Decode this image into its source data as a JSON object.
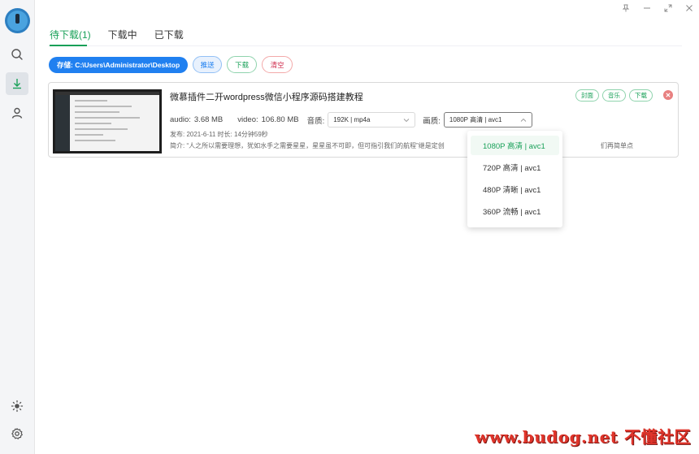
{
  "window_controls": [
    "pin-icon",
    "minimize-icon",
    "maximize-icon",
    "close-icon"
  ],
  "sidebar": {
    "avatar_text": "",
    "items": [
      {
        "name": "search",
        "icon": "search-icon"
      },
      {
        "name": "download",
        "icon": "download-icon",
        "active": true
      },
      {
        "name": "user",
        "icon": "user-icon"
      }
    ],
    "bottom": [
      {
        "name": "theme",
        "icon": "sun-icon"
      },
      {
        "name": "settings",
        "icon": "gear-icon"
      }
    ]
  },
  "tabs": [
    {
      "label": "待下载(1)",
      "active": true
    },
    {
      "label": "下载中",
      "active": false
    },
    {
      "label": "已下载",
      "active": false
    }
  ],
  "toolbar": {
    "path_label": "存储: C:\\Users\\Administrator\\Desktop",
    "push_label": "推送",
    "download_label": "下载",
    "clear_label": "清空"
  },
  "item": {
    "title": "微慕插件二开wordpress微信小程序源码搭建教程",
    "tags": [
      "封面",
      "音乐",
      "下载"
    ],
    "audio_label": "audio:",
    "audio_size": "3.68 MB",
    "video_label": "video:",
    "video_size": "106.80 MB",
    "audio_quality_label": "音质:",
    "audio_quality_value": "192K | mp4a",
    "video_quality_label": "画质:",
    "video_quality_value": "1080P 高清 | avc1",
    "publish": "发布: 2021-6-11 时长: 14分钟59秒",
    "intro": "简介: “人之所以需要理想，犹如水手之需要星星，星星虽不可即，但可指引我们的航程”继是定创",
    "intro_tail": "们再简单点，让我们..."
  },
  "dropdown": {
    "options": [
      "1080P 高清 | avc1",
      "720P 高清 | avc1",
      "480P 清晰 | avc1",
      "360P 流畅 | avc1"
    ],
    "selected_index": 0
  },
  "watermark": "www.budog.net 不懂社区",
  "colors": {
    "accent_green": "#18a058",
    "primary_blue": "#2080f0",
    "danger_red": "#d03050"
  }
}
